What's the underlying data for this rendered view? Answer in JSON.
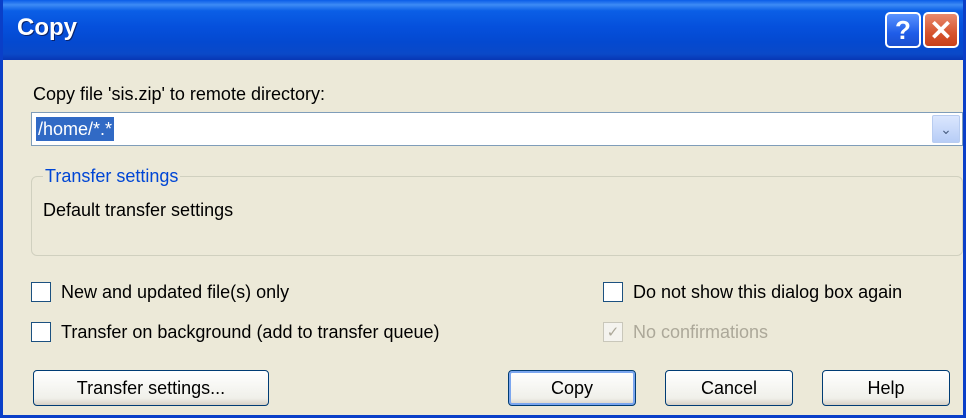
{
  "window": {
    "title": "Copy",
    "help_glyph": "?",
    "close_glyph": "✕"
  },
  "destination": {
    "label": "Copy file 'sis.zip' to remote directory:",
    "value": "/home/*.*",
    "dropdown_glyph": "⌄"
  },
  "transfer_group": {
    "legend": "Transfer settings",
    "summary": "Default transfer settings"
  },
  "options": {
    "new_updated_only": {
      "label": "New and updated file(s) only",
      "checked": false
    },
    "background": {
      "label": "Transfer on background (add to transfer queue)",
      "checked": false
    },
    "dont_show_again": {
      "label": "Do not show this dialog box again",
      "checked": false
    },
    "no_confirmations": {
      "label": "No confirmations",
      "checked": true,
      "disabled": true,
      "check_glyph": "✓"
    }
  },
  "buttons": {
    "transfer_settings": "Transfer settings...",
    "copy": "Copy",
    "cancel": "Cancel",
    "help": "Help"
  },
  "colors": {
    "titlebar": "#0550dc",
    "dialog_bg": "#ece9d8",
    "selection": "#316ac5",
    "group_legend": "#0046d5",
    "close_button": "#d6542e"
  }
}
